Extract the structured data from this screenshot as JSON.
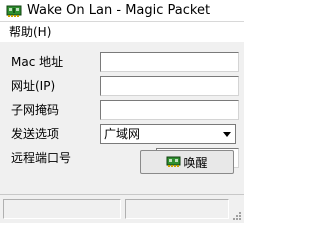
{
  "window": {
    "title": "Wake On Lan - Magic Packet",
    "app_icon": "network-card-icon"
  },
  "menu": {
    "items": [
      {
        "label": "帮助(H)"
      }
    ]
  },
  "form": {
    "mac_label": "Mac 地址",
    "mac_value": "",
    "ip_label": "网址(IP)",
    "ip_value": "",
    "mask_label": "子网掩码",
    "mask_value": "",
    "send_option_label": "发送选项",
    "send_option_value": "广域网",
    "port_label": "远程端口号",
    "port_value": ""
  },
  "actions": {
    "wake_label": "唤醒",
    "wake_icon": "network-card-icon"
  },
  "colors": {
    "window_bg": "#f0f0f0",
    "title_bg": "#ffffff",
    "icon_green": "#2f8f2f"
  }
}
